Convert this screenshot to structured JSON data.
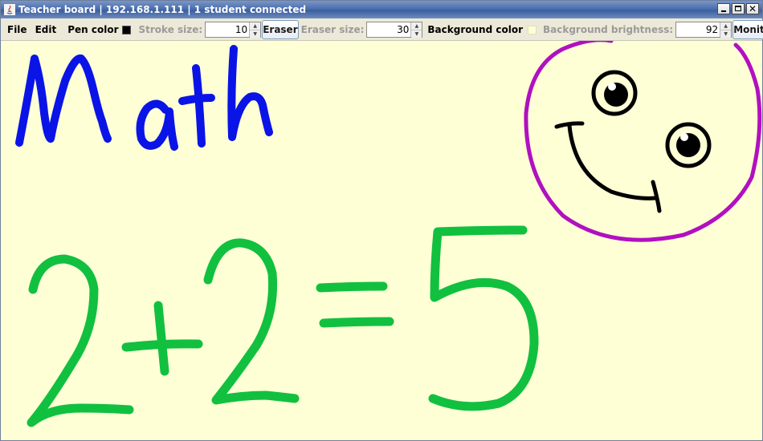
{
  "window": {
    "title": "Teacher board | 192.168.1.111 | 1 student connected"
  },
  "toolbar": {
    "menu_file": "File",
    "menu_edit": "Edit",
    "pen_color_label": "Pen color",
    "pen_color": "#000000",
    "stroke_size_label": "Stroke size:",
    "stroke_size": "10",
    "eraser_button": "Eraser",
    "eraser_size_label": "Eraser size:",
    "eraser_size": "30",
    "background_color_label": "Background color",
    "background_color": "#ffffd6",
    "background_brightness_label": "Background brightness:",
    "background_brightness": "92",
    "monitor_button": "Monitor"
  },
  "board": {
    "background": "#ffffd6",
    "ink_colors": {
      "blue": "#0a14e6",
      "green": "#12c040",
      "purple": "#b010c0",
      "black": "#000000"
    },
    "drawings": [
      "Math",
      "2+2=5",
      "smiley-face"
    ]
  }
}
